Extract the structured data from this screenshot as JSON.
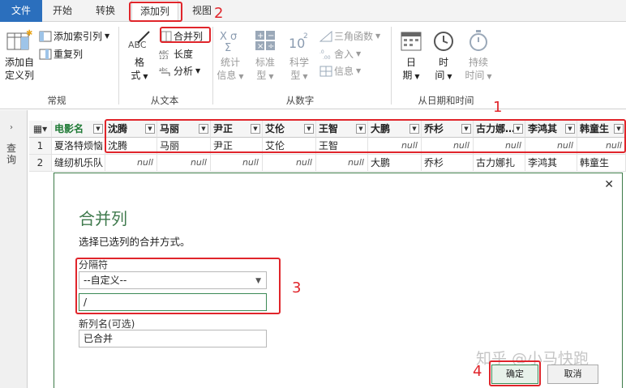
{
  "tabs": {
    "file": "文件",
    "home": "开始",
    "transform": "转换",
    "add_column": "添加列",
    "view": "视图"
  },
  "ribbon": {
    "general": {
      "custom_column": [
        "添加自",
        "定义列"
      ],
      "index_column": "添加索引列",
      "duplicate_column": "重复列",
      "label": "常规"
    },
    "from_text": {
      "format": [
        "格",
        "式"
      ],
      "merge_columns": "合并列",
      "length": "长度",
      "parse": "分析",
      "label": "从文本"
    },
    "from_number": {
      "statistics": [
        "统计",
        "信息"
      ],
      "standard": [
        "标准",
        "型"
      ],
      "scientific": [
        "科学",
        "型"
      ],
      "trigonometry": "三角函数",
      "rounding": "舍入",
      "information": "信息",
      "label": "从数字"
    },
    "from_datetime": {
      "date": [
        "日",
        "期"
      ],
      "time": [
        "时",
        "间"
      ],
      "duration": [
        "持续",
        "时间"
      ],
      "label": "从日期和时间"
    }
  },
  "left_nav": {
    "label": "查询"
  },
  "grid": {
    "headers": [
      "电影名",
      "沈腾",
      "马丽",
      "尹正",
      "艾伦",
      "王智",
      "大鹏",
      "乔杉",
      "古力娜…",
      "李鸿其",
      "韩童生"
    ],
    "rows": [
      {
        "num": "1",
        "cells": [
          "夏洛特烦恼",
          "沈腾",
          "马丽",
          "尹正",
          "艾伦",
          "王智",
          "null",
          "null",
          "null",
          "null",
          "null"
        ]
      },
      {
        "num": "2",
        "cells": [
          "缝纫机乐队",
          "null",
          "null",
          "null",
          "null",
          "null",
          "大鹏",
          "乔杉",
          "古力娜扎",
          "李鸿其",
          "韩童生"
        ]
      }
    ]
  },
  "dialog": {
    "title": "合并列",
    "description": "选择已选列的合并方式。",
    "separator_label": "分隔符",
    "separator_value": "--自定义--",
    "custom_value": "/",
    "new_name_label": "新列名(可选)",
    "new_name_value": "已合并",
    "ok": "确定",
    "cancel": "取消",
    "watermark": "知乎 @小马快跑"
  },
  "annotations": [
    "1",
    "2",
    "3",
    "4"
  ],
  "colors": {
    "file_tab": "#2b6fbd",
    "accent": "#3f7a4d",
    "annotation": "#e0252b"
  }
}
